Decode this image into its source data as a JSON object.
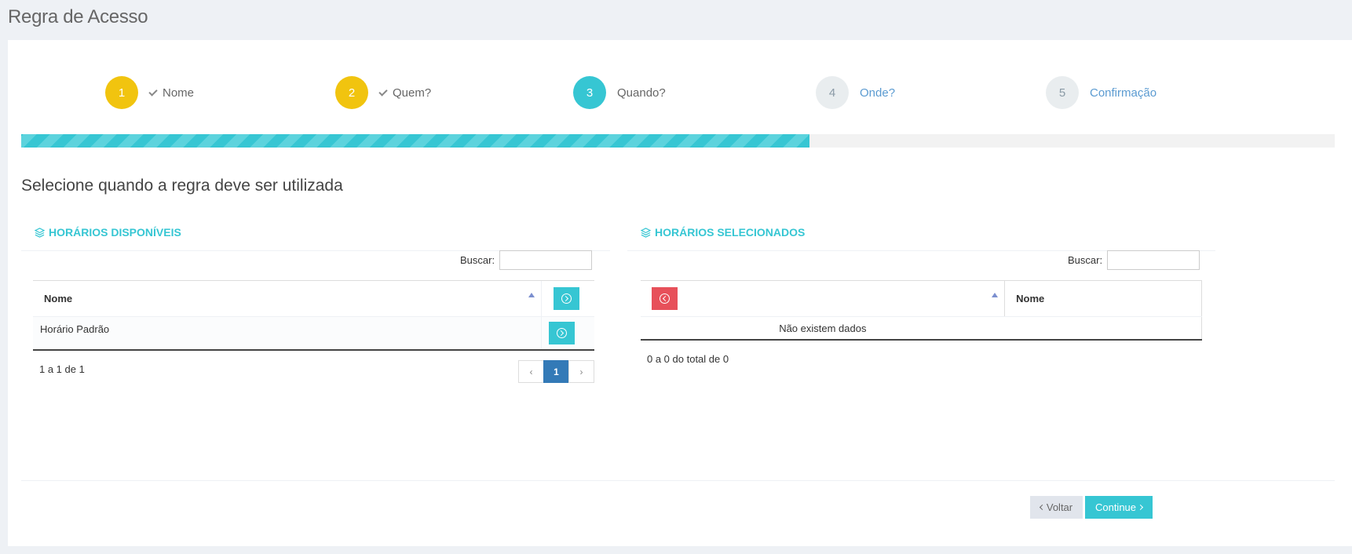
{
  "page": {
    "title": "Regra de Acesso",
    "section_heading": "Selecione quando a regra deve ser utilizada"
  },
  "steps": [
    {
      "number": "1",
      "label": "Nome",
      "state": "done"
    },
    {
      "number": "2",
      "label": "Quem?",
      "state": "done"
    },
    {
      "number": "3",
      "label": "Quando?",
      "state": "active"
    },
    {
      "number": "4",
      "label": "Onde?",
      "state": "todo"
    },
    {
      "number": "5",
      "label": "Confirmação",
      "state": "todo"
    }
  ],
  "progress": {
    "percent": 60
  },
  "available": {
    "title": "HORÁRIOS DISPONÍVEIS",
    "search_label": "Buscar:",
    "columns": [
      "Nome"
    ],
    "rows": [
      {
        "nome": "Horário Padrão"
      }
    ],
    "info": "1 a 1 de 1",
    "pagination": {
      "prev": "‹",
      "current": "1",
      "next": "›"
    }
  },
  "selected": {
    "title": "HORÁRIOS SELECIONADOS",
    "search_label": "Buscar:",
    "columns": [
      "Nome"
    ],
    "empty_text": "Não existem dados",
    "info": "0 a 0 do total de 0"
  },
  "buttons": {
    "back": "Voltar",
    "continue": "Continue"
  },
  "colors": {
    "accent": "#36c6d3",
    "done": "#f1c40f",
    "danger": "#e7505a",
    "primary": "#337ab7"
  },
  "icons": {
    "heading": "layers-icon",
    "add": "circle-arrow-right-icon",
    "remove": "circle-arrow-left-icon"
  }
}
